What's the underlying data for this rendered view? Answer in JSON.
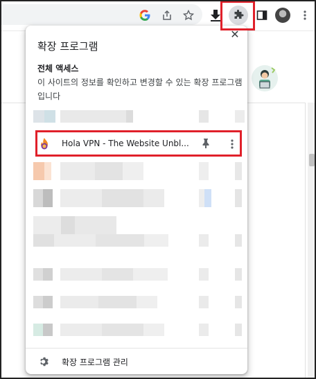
{
  "toolbar": {
    "icons": [
      "google-icon",
      "share-icon",
      "star-icon",
      "download-icon",
      "extensions-icon",
      "sidepanel-icon",
      "profile-avatar",
      "menu-icon"
    ]
  },
  "popup": {
    "title": "확장 프로그램",
    "close_label": "✕",
    "section_title": "전체 액세스",
    "section_desc": "이 사이트의 정보를 확인하고 변경할 수 있는 확장 프로그램입니다",
    "highlighted_extension": {
      "name": "Hola VPN - The Website Unbl...",
      "icon": "hola-fire-icon",
      "pin_icon": "pin-icon",
      "more_icon": "more-vert-icon"
    },
    "manage_label": "확장 프로그램 관리",
    "manage_icon": "gear-icon"
  },
  "colors": {
    "highlight": "#e0202a",
    "popup_bg": "#ffffff",
    "extensions_button_active": "#dadce0"
  }
}
